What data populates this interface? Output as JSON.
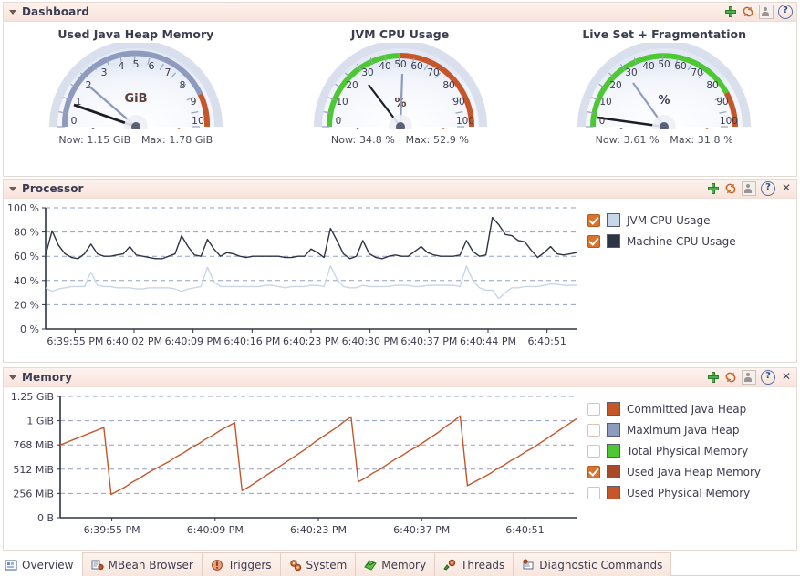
{
  "sections": {
    "dashboard": {
      "title": "Dashboard",
      "tools": [
        "add-icon",
        "refresh-icon",
        "person-icon",
        "help-icon"
      ],
      "gauges": [
        {
          "title": "Used Java Heap Memory",
          "unit": "GiB",
          "min": 0,
          "max": 10,
          "ticks": [
            0,
            1,
            2,
            3,
            4,
            5,
            6,
            7,
            8,
            9,
            10
          ],
          "now_value": 1.15,
          "max_value": 1.78,
          "now_label": "Now: 1.15 GiB",
          "max_label": "Max: 1.78 GiB",
          "arc_segments": [
            {
              "from": 0,
              "to": 9.0,
              "color": "#8e9bbe"
            },
            {
              "from": 9.0,
              "to": 10,
              "color": "#c4562a"
            }
          ]
        },
        {
          "title": "JVM CPU Usage",
          "unit": "%",
          "min": 0,
          "max": 100,
          "ticks": [
            0,
            10,
            20,
            30,
            40,
            50,
            60,
            70,
            80,
            90,
            100
          ],
          "now_value": 34.8,
          "max_value": 52.9,
          "now_label": "Now: 34.8 %",
          "max_label": "Max: 52.9 %",
          "arc_segments": [
            {
              "from": 0,
              "to": 50,
              "color": "#4bc832"
            },
            {
              "from": 50,
              "to": 100,
              "color": "#c4562a"
            }
          ]
        },
        {
          "title": "Live Set + Fragmentation",
          "unit": "%",
          "min": 0,
          "max": 100,
          "ticks": [
            0,
            10,
            20,
            30,
            40,
            50,
            60,
            70,
            80,
            90,
            100
          ],
          "now_value": 3.61,
          "max_value": 31.8,
          "now_label": "Now: 3.61 %",
          "max_label": "Max: 31.8 %",
          "arc_segments": [
            {
              "from": 0,
              "to": 84,
              "color": "#4bc832"
            },
            {
              "from": 84,
              "to": 100,
              "color": "#c4562a"
            }
          ]
        }
      ]
    },
    "processor": {
      "title": "Processor",
      "tools": [
        "add-icon",
        "refresh-icon",
        "person-icon",
        "help-icon",
        "close-icon"
      ],
      "legend": [
        {
          "label": "JVM CPU Usage",
          "checked": true,
          "color": "#c8d6ea"
        },
        {
          "label": "Machine CPU Usage",
          "checked": true,
          "color": "#2f3444"
        }
      ]
    },
    "memory": {
      "title": "Memory",
      "tools": [
        "add-icon",
        "refresh-icon",
        "person-icon",
        "help-icon",
        "close-icon"
      ],
      "legend": [
        {
          "label": "Committed Java Heap",
          "checked": false,
          "color": "#c4562a"
        },
        {
          "label": "Maximum Java Heap",
          "checked": false,
          "color": "#8e9bbe"
        },
        {
          "label": "Total Physical Memory",
          "checked": false,
          "color": "#4bc832"
        },
        {
          "label": "Used Java Heap Memory",
          "checked": true,
          "color": "#a8492a"
        },
        {
          "label": "Used Physical Memory",
          "checked": false,
          "color": "#c4562a"
        }
      ]
    }
  },
  "chart_data": [
    {
      "id": "processor",
      "type": "line",
      "title": "Processor",
      "xlabel": "",
      "ylabel": "",
      "ylim": [
        0,
        100
      ],
      "yticks": [
        0,
        20,
        40,
        60,
        80,
        100
      ],
      "ytick_labels": [
        "0 %",
        "20 %",
        "40 %",
        "60 %",
        "80 %",
        "100 %"
      ],
      "xtick_labels": [
        "6:39:55 PM",
        "6:40:02 PM",
        "6:40:09 PM",
        "6:40:16 PM",
        "6:40:23 PM",
        "6:40:30 PM",
        "6:40:37 PM",
        "6:40:44 PM",
        "6:40:51"
      ],
      "grid": true,
      "legend_position": "right",
      "series": [
        {
          "name": "Machine CPU Usage",
          "color": "#2f3444",
          "values": [
            61,
            81,
            69,
            62,
            59,
            58,
            62,
            70,
            62,
            60,
            60,
            61,
            62,
            68,
            61,
            60,
            59,
            58,
            58,
            60,
            62,
            77,
            68,
            61,
            60,
            74,
            66,
            60,
            63,
            62,
            60,
            59,
            60,
            60,
            60,
            60,
            60,
            59,
            59,
            60,
            60,
            66,
            63,
            59,
            83,
            73,
            62,
            58,
            60,
            73,
            62,
            59,
            58,
            60,
            61,
            60,
            60,
            64,
            68,
            63,
            61,
            60,
            60,
            60,
            61,
            73,
            64,
            60,
            61,
            92,
            86,
            78,
            77,
            73,
            72,
            65,
            59,
            63,
            68,
            62,
            61,
            62,
            63
          ]
        },
        {
          "name": "JVM CPU Usage",
          "color": "#c8d6ea",
          "values": [
            34,
            31,
            33,
            34,
            35,
            35,
            35,
            47,
            36,
            35,
            35,
            34,
            34,
            34,
            33,
            33,
            34,
            34,
            34,
            34,
            33,
            31,
            33,
            34,
            35,
            51,
            39,
            35,
            35,
            35,
            35,
            35,
            35,
            35,
            36,
            36,
            35,
            34,
            35,
            35,
            35,
            36,
            36,
            35,
            52,
            41,
            35,
            34,
            34,
            36,
            35,
            35,
            35,
            35,
            36,
            36,
            36,
            35,
            35,
            36,
            36,
            36,
            36,
            36,
            35,
            52,
            40,
            34,
            32,
            32,
            25,
            30,
            34,
            34,
            35,
            35,
            35,
            36,
            37,
            37,
            36,
            36,
            36
          ]
        }
      ]
    },
    {
      "id": "memory",
      "type": "line",
      "title": "Memory",
      "xlabel": "",
      "ylabel": "",
      "ylim": [
        0,
        1.25
      ],
      "yticks": [
        0,
        0.25,
        0.5,
        0.75,
        1,
        1.25
      ],
      "ytick_labels": [
        "0 B",
        "256 MiB",
        "512 MiB",
        "768 MiB",
        "1 GiB",
        "1.25 GiB"
      ],
      "xtick_labels": [
        "6:39:55 PM",
        "6:40:09 PM",
        "6:40:23 PM",
        "6:40:37 PM",
        "6:40:51"
      ],
      "grid": true,
      "legend_position": "right",
      "series": [
        {
          "name": "Used Java Heap Memory",
          "color": "#c4562a",
          "values": [
            0.75,
            0.78,
            0.81,
            0.84,
            0.87,
            0.9,
            0.93,
            0.24,
            0.28,
            0.32,
            0.37,
            0.41,
            0.46,
            0.5,
            0.54,
            0.58,
            0.63,
            0.67,
            0.72,
            0.76,
            0.81,
            0.85,
            0.9,
            0.94,
            0.98,
            0.28,
            0.32,
            0.37,
            0.42,
            0.47,
            0.52,
            0.57,
            0.62,
            0.67,
            0.72,
            0.78,
            0.83,
            0.88,
            0.93,
            0.99,
            1.04,
            0.37,
            0.41,
            0.46,
            0.5,
            0.55,
            0.6,
            0.64,
            0.69,
            0.73,
            0.78,
            0.83,
            0.88,
            0.94,
            0.99,
            1.05,
            0.33,
            0.37,
            0.41,
            0.45,
            0.5,
            0.54,
            0.59,
            0.63,
            0.68,
            0.72,
            0.77,
            0.82,
            0.87,
            0.92,
            0.97,
            1.02
          ]
        }
      ]
    }
  ],
  "tabs": [
    {
      "label": "Overview",
      "icon": "overview-icon",
      "active": true
    },
    {
      "label": "MBean Browser",
      "icon": "mbean-icon",
      "active": false
    },
    {
      "label": "Triggers",
      "icon": "trigger-icon",
      "active": false
    },
    {
      "label": "System",
      "icon": "system-icon",
      "active": false
    },
    {
      "label": "Memory",
      "icon": "memory-icon",
      "active": false
    },
    {
      "label": "Threads",
      "icon": "threads-icon",
      "active": false
    },
    {
      "label": "Diagnostic Commands",
      "icon": "diagnostic-icon",
      "active": false
    }
  ]
}
